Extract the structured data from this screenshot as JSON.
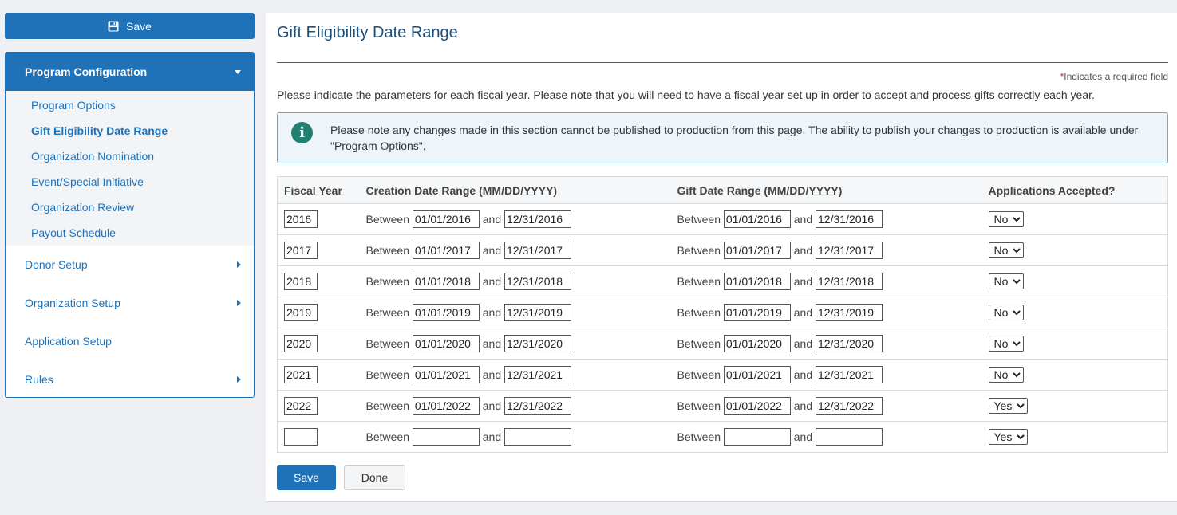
{
  "sidebar": {
    "save_label": "Save",
    "section_label": "Program Configuration",
    "sub_items": [
      {
        "label": "Program Options",
        "active": false
      },
      {
        "label": "Gift Eligibility Date Range",
        "active": true
      },
      {
        "label": "Organization Nomination",
        "active": false
      },
      {
        "label": "Event/Special Initiative",
        "active": false
      },
      {
        "label": "Organization Review",
        "active": false
      },
      {
        "label": "Payout Schedule",
        "active": false
      }
    ],
    "nav_items": [
      {
        "label": "Donor Setup",
        "has_arrow": true
      },
      {
        "label": "Organization Setup",
        "has_arrow": true
      },
      {
        "label": "Application Setup",
        "has_arrow": false
      },
      {
        "label": "Rules",
        "has_arrow": true
      }
    ]
  },
  "main": {
    "title": "Gift Eligibility Date Range",
    "required_star": "*",
    "required_note": "Indicates a required field",
    "intro": "Please indicate the parameters for each fiscal year. Please note that you will need to have a fiscal year set up in order to accept and process gifts correctly each year.",
    "info": "Please note any changes made in this section cannot be published to production from this page. The ability to publish your changes to production is available under \"Program Options\".",
    "table": {
      "headers": [
        "Fiscal Year",
        "Creation Date Range (MM/DD/YYYY)",
        "Gift Date Range (MM/DD/YYYY)",
        "Applications Accepted?"
      ],
      "between_label": "Between",
      "and_label": "and",
      "rows": [
        {
          "year": "2016",
          "create_start": "01/01/2016",
          "create_end": "12/31/2016",
          "gift_start": "01/01/2016",
          "gift_end": "12/31/2016",
          "accepted": "No"
        },
        {
          "year": "2017",
          "create_start": "01/01/2017",
          "create_end": "12/31/2017",
          "gift_start": "01/01/2017",
          "gift_end": "12/31/2017",
          "accepted": "No"
        },
        {
          "year": "2018",
          "create_start": "01/01/2018",
          "create_end": "12/31/2018",
          "gift_start": "01/01/2018",
          "gift_end": "12/31/2018",
          "accepted": "No"
        },
        {
          "year": "2019",
          "create_start": "01/01/2019",
          "create_end": "12/31/2019",
          "gift_start": "01/01/2019",
          "gift_end": "12/31/2019",
          "accepted": "No"
        },
        {
          "year": "2020",
          "create_start": "01/01/2020",
          "create_end": "12/31/2020",
          "gift_start": "01/01/2020",
          "gift_end": "12/31/2020",
          "accepted": "No"
        },
        {
          "year": "2021",
          "create_start": "01/01/2021",
          "create_end": "12/31/2021",
          "gift_start": "01/01/2021",
          "gift_end": "12/31/2021",
          "accepted": "No"
        },
        {
          "year": "2022",
          "create_start": "01/01/2022",
          "create_end": "12/31/2022",
          "gift_start": "01/01/2022",
          "gift_end": "12/31/2022",
          "accepted": "Yes"
        },
        {
          "year": "",
          "create_start": "",
          "create_end": "",
          "gift_start": "",
          "gift_end": "",
          "accepted": "Yes"
        }
      ]
    },
    "save_label": "Save",
    "done_label": "Done"
  },
  "colors": {
    "primary": "#1f72b8",
    "title": "#1d4e7a",
    "info_bg": "#eef5fa",
    "info_icon": "#21806f",
    "required": "#c0392b"
  },
  "icons": {
    "save": "floppy-disk-icon",
    "info": "info-circle-icon",
    "expand": "chevron-down-icon",
    "collapsed": "chevron-right-icon"
  }
}
